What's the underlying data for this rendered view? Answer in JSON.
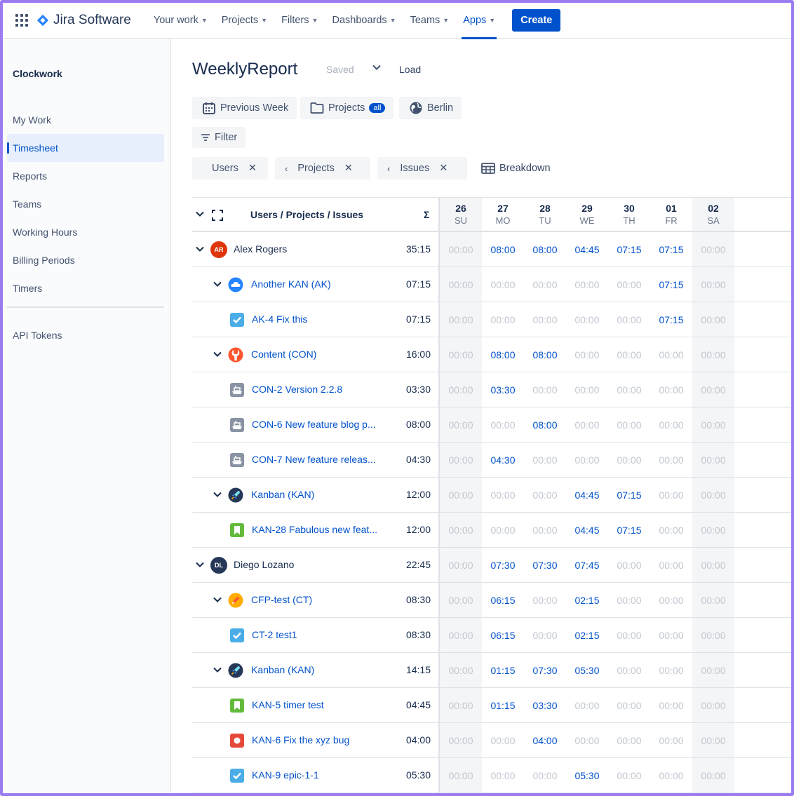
{
  "topnav": {
    "product": "Jira Software",
    "items": [
      {
        "label": "Your work",
        "active": false
      },
      {
        "label": "Projects",
        "active": false
      },
      {
        "label": "Filters",
        "active": false
      },
      {
        "label": "Dashboards",
        "active": false
      },
      {
        "label": "Teams",
        "active": false
      },
      {
        "label": "Apps",
        "active": true
      }
    ],
    "create_label": "Create"
  },
  "sidebar": {
    "title": "Clockwork",
    "items": [
      {
        "label": "My Work",
        "active": false
      },
      {
        "label": "Timesheet",
        "active": true
      },
      {
        "label": "Reports",
        "active": false
      },
      {
        "label": "Teams",
        "active": false
      },
      {
        "label": "Working Hours",
        "active": false
      },
      {
        "label": "Billing Periods",
        "active": false
      },
      {
        "label": "Timers",
        "active": false
      }
    ],
    "bottom_item": "API Tokens"
  },
  "report": {
    "title": "WeeklyReport",
    "saved_label": "Saved",
    "load_label": "Load",
    "previous_week_label": "Previous Week",
    "projects_label": "Projects",
    "projects_badge": "all",
    "timezone_label": "Berlin",
    "filter_label": "Filter",
    "group_chips": [
      "Users",
      "Projects",
      "Issues"
    ],
    "breakdown_label": "Breakdown"
  },
  "table": {
    "header_title": "Users / Projects / Issues",
    "sigma": "Σ",
    "days": [
      {
        "num": "26",
        "name": "SU",
        "weekend": true
      },
      {
        "num": "27",
        "name": "MO",
        "weekend": false
      },
      {
        "num": "28",
        "name": "TU",
        "weekend": false
      },
      {
        "num": "29",
        "name": "WE",
        "weekend": false
      },
      {
        "num": "30",
        "name": "TH",
        "weekend": false
      },
      {
        "num": "01",
        "name": "FR",
        "weekend": false
      },
      {
        "num": "02",
        "name": "SA",
        "weekend": true
      }
    ],
    "rows": [
      {
        "level": 0,
        "type": "user",
        "initials": "AR",
        "avatar_color": "#de350b",
        "label": "Alex Rogers",
        "sum": "35:15",
        "values": [
          "00:00",
          "08:00",
          "08:00",
          "04:45",
          "07:15",
          "07:15",
          "00:00"
        ]
      },
      {
        "level": 1,
        "type": "project",
        "icon": "cloud-project-icon",
        "label": "Another KAN (AK)",
        "sum": "07:15",
        "values": [
          "00:00",
          "00:00",
          "00:00",
          "00:00",
          "00:00",
          "07:15",
          "00:00"
        ]
      },
      {
        "level": 2,
        "type": "issue",
        "icon": "task-icon",
        "label": "AK-4 Fix this",
        "sum": "07:15",
        "values": [
          "00:00",
          "00:00",
          "00:00",
          "00:00",
          "00:00",
          "07:15",
          "00:00"
        ]
      },
      {
        "level": 1,
        "type": "project",
        "icon": "wrench-project-icon",
        "label": "Content (CON)",
        "sum": "16:00",
        "values": [
          "00:00",
          "08:00",
          "08:00",
          "00:00",
          "00:00",
          "00:00",
          "00:00"
        ]
      },
      {
        "level": 2,
        "type": "issue",
        "icon": "ship-icon",
        "label": "CON-2 Version 2.2.8",
        "sum": "03:30",
        "values": [
          "00:00",
          "03:30",
          "00:00",
          "00:00",
          "00:00",
          "00:00",
          "00:00"
        ]
      },
      {
        "level": 2,
        "type": "issue",
        "icon": "ship-icon",
        "label": "CON-6 New feature blog p...",
        "sum": "08:00",
        "values": [
          "00:00",
          "00:00",
          "08:00",
          "00:00",
          "00:00",
          "00:00",
          "00:00"
        ]
      },
      {
        "level": 2,
        "type": "issue",
        "icon": "ship-icon",
        "label": "CON-7 New feature releas...",
        "sum": "04:30",
        "values": [
          "00:00",
          "04:30",
          "00:00",
          "00:00",
          "00:00",
          "00:00",
          "00:00"
        ]
      },
      {
        "level": 1,
        "type": "project",
        "icon": "rocket-project-icon",
        "label": "Kanban (KAN)",
        "sum": "12:00",
        "values": [
          "00:00",
          "00:00",
          "00:00",
          "04:45",
          "07:15",
          "00:00",
          "00:00"
        ]
      },
      {
        "level": 2,
        "type": "issue",
        "icon": "story-icon",
        "label": "KAN-28 Fabulous new feat...",
        "sum": "12:00",
        "values": [
          "00:00",
          "00:00",
          "00:00",
          "04:45",
          "07:15",
          "00:00",
          "00:00"
        ]
      },
      {
        "level": 0,
        "type": "user",
        "initials": "DL",
        "avatar_color": "#253858",
        "label": "Diego Lozano",
        "sum": "22:45",
        "values": [
          "00:00",
          "07:30",
          "07:30",
          "07:45",
          "00:00",
          "00:00",
          "00:00"
        ]
      },
      {
        "level": 1,
        "type": "project",
        "icon": "pencil-project-icon",
        "label": "CFP-test (CT)",
        "sum": "08:30",
        "values": [
          "00:00",
          "06:15",
          "00:00",
          "02:15",
          "00:00",
          "00:00",
          "00:00"
        ]
      },
      {
        "level": 2,
        "type": "issue",
        "icon": "task-icon",
        "label": "CT-2 test1",
        "sum": "08:30",
        "values": [
          "00:00",
          "06:15",
          "00:00",
          "02:15",
          "00:00",
          "00:00",
          "00:00"
        ]
      },
      {
        "level": 1,
        "type": "project",
        "icon": "rocket-project-icon",
        "label": "Kanban (KAN)",
        "sum": "14:15",
        "values": [
          "00:00",
          "01:15",
          "07:30",
          "05:30",
          "00:00",
          "00:00",
          "00:00"
        ]
      },
      {
        "level": 2,
        "type": "issue",
        "icon": "story-icon",
        "label": "KAN-5 timer test",
        "sum": "04:45",
        "values": [
          "00:00",
          "01:15",
          "03:30",
          "00:00",
          "00:00",
          "00:00",
          "00:00"
        ]
      },
      {
        "level": 2,
        "type": "issue",
        "icon": "bug-icon",
        "label": "KAN-6 Fix the xyz bug",
        "sum": "04:00",
        "values": [
          "00:00",
          "00:00",
          "04:00",
          "00:00",
          "00:00",
          "00:00",
          "00:00"
        ]
      },
      {
        "level": 2,
        "type": "issue",
        "icon": "task-icon",
        "label": "KAN-9 epic-1-1",
        "sum": "05:30",
        "values": [
          "00:00",
          "00:00",
          "00:00",
          "05:30",
          "00:00",
          "00:00",
          "00:00"
        ]
      }
    ]
  }
}
